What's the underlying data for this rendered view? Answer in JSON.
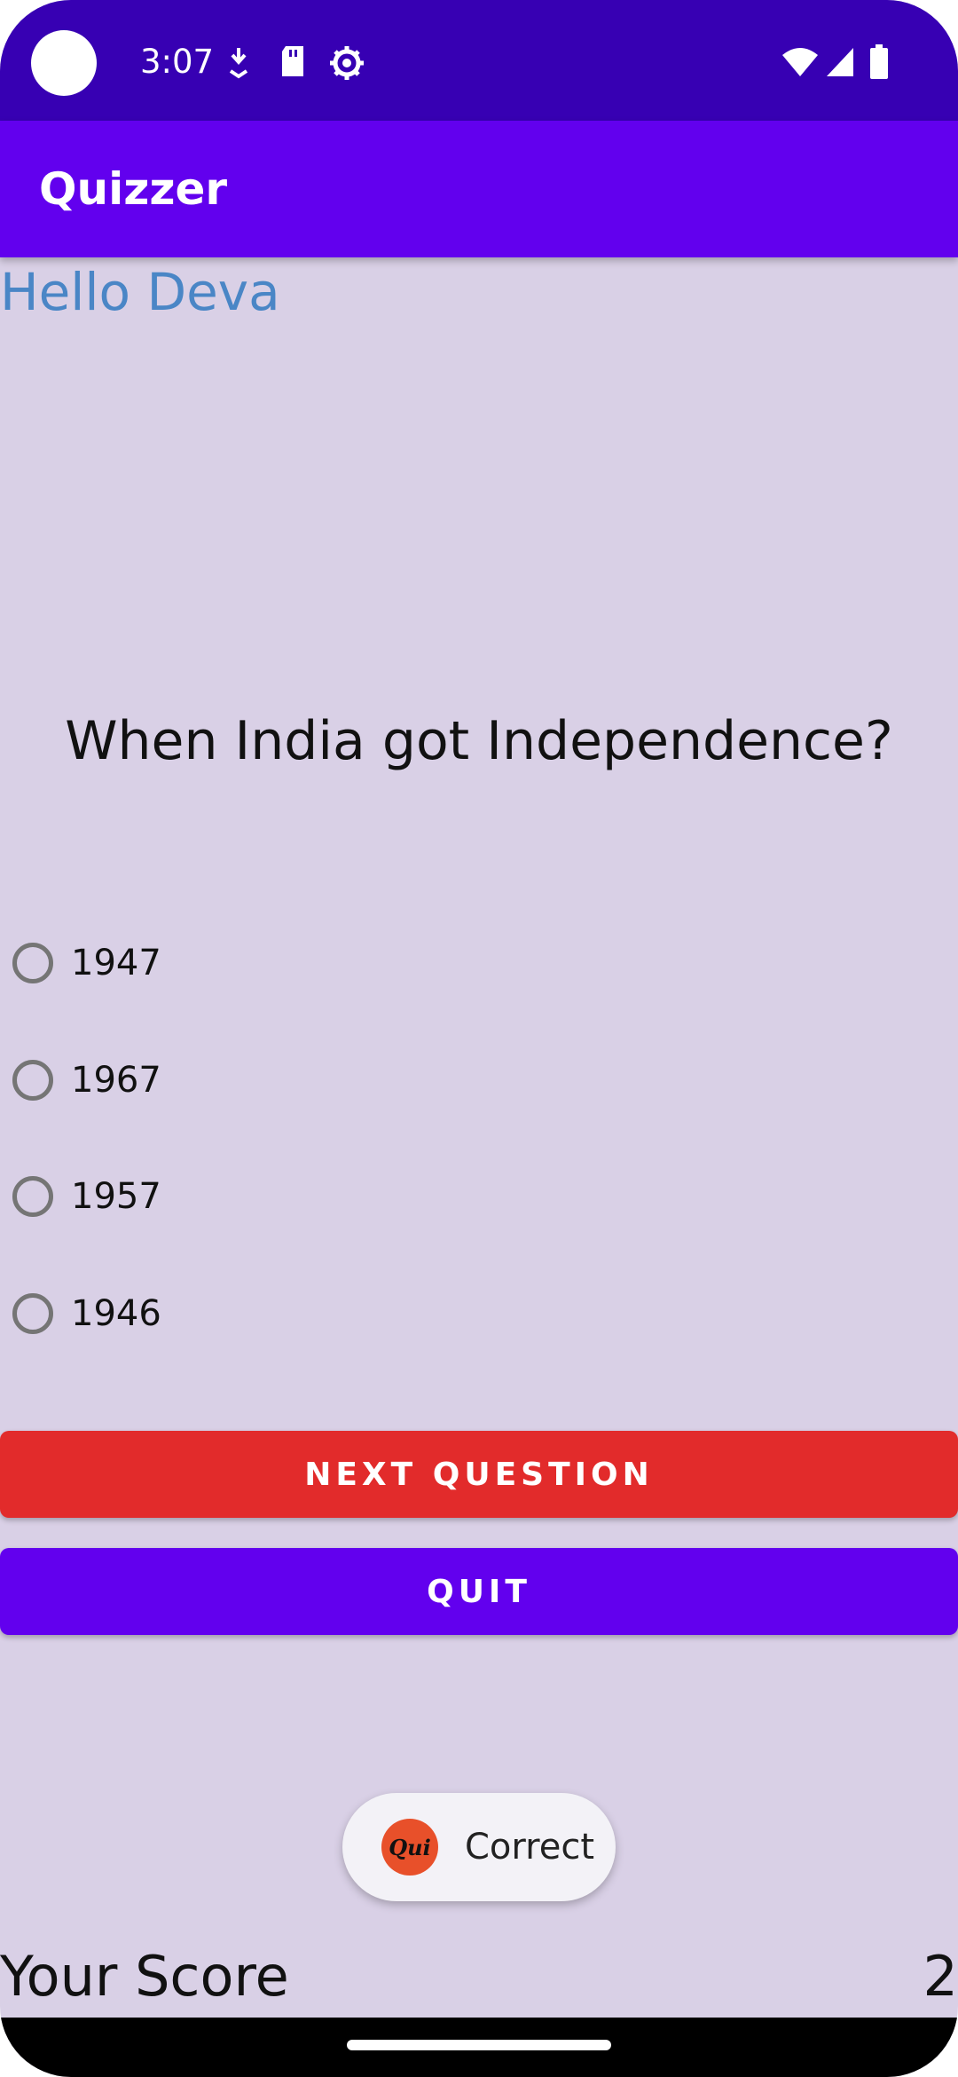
{
  "status_bar": {
    "time": "3:07",
    "left_icons": [
      "camera-dot",
      "notification-icon",
      "sd-card-icon",
      "settings-gear-icon"
    ],
    "right_icons": [
      "wifi-icon",
      "signal-icon",
      "battery-icon"
    ]
  },
  "app_bar": {
    "title": "Quizzer"
  },
  "greeting": "Hello Deva",
  "question": "When India got Independence?",
  "options": [
    "1947",
    "1967",
    "1957",
    "1946"
  ],
  "buttons": {
    "next": "NEXT QUESTION",
    "quit": "QUIT"
  },
  "toast": {
    "text": "Correct",
    "logo_text": "Qui"
  },
  "score": {
    "label": "Your Score",
    "value": "2"
  },
  "colors": {
    "status_bar": "#3700b3",
    "app_bar": "#6200ee",
    "background": "#d9d0e6",
    "greeting": "#4a86c6",
    "next_button": "#e22b2b",
    "quit_button": "#6200ee"
  }
}
